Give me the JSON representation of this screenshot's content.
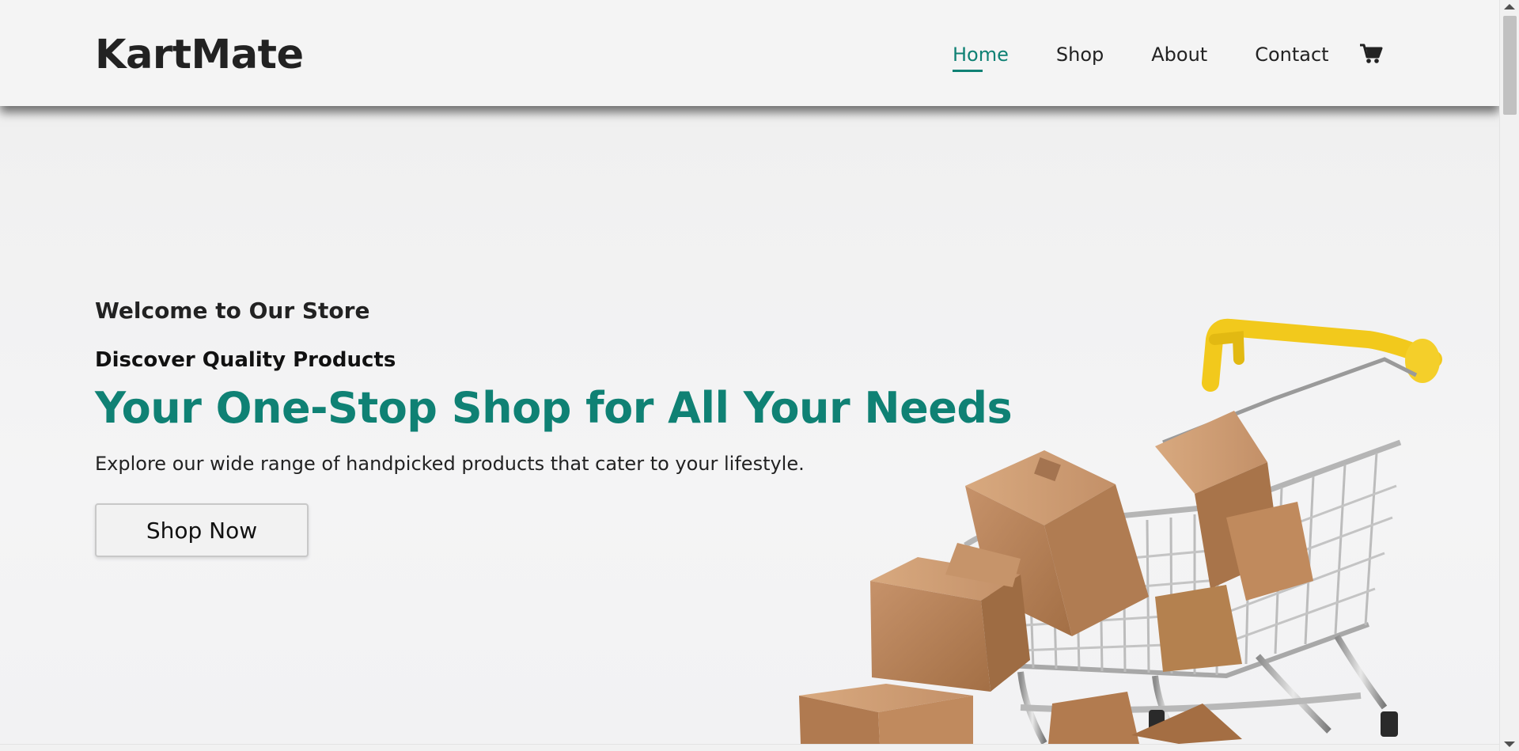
{
  "header": {
    "logo": "KartMate",
    "nav": [
      {
        "label": "Home",
        "active": true
      },
      {
        "label": "Shop",
        "active": false
      },
      {
        "label": "About",
        "active": false
      },
      {
        "label": "Contact",
        "active": false
      }
    ],
    "cart_icon": "shopping-cart-icon"
  },
  "hero": {
    "welcome": "Welcome to Our Store",
    "subtitle": "Discover Quality Products",
    "headline": "Your One-Stop Shop for All Your Needs",
    "description": "Explore our wide range of handpicked products that cater to your lifestyle.",
    "cta_label": "Shop Now",
    "illustration": "shopping-cart-with-boxes-image"
  },
  "colors": {
    "accent": "#0f8174",
    "text": "#222222",
    "background": "#f2f2f2",
    "cart_handle": "#f2c91c",
    "box": "#b98455"
  }
}
